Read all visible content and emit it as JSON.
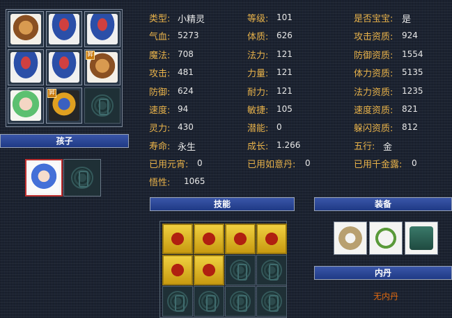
{
  "pet_list": {
    "cells": [
      {
        "icon": "monkey-sage-pet-icon",
        "art": "monkey"
      },
      {
        "icon": "shell-pet-icon",
        "art": "shell"
      },
      {
        "icon": "shell-pet-icon",
        "art": "shell"
      },
      {
        "icon": "shell-pet-icon",
        "art": "shell"
      },
      {
        "icon": "shell-pet-icon",
        "art": "shell"
      },
      {
        "icon": "monkey-pet-icon",
        "art": "monkey",
        "badge": "昇"
      },
      {
        "icon": "green-hair-girl-pet-icon",
        "art": "girl"
      },
      {
        "icon": "armored-pet-icon",
        "art": "knight",
        "badge": "昇"
      },
      {
        "icon": "empty-slot-icon",
        "art": "empty"
      }
    ]
  },
  "child": {
    "title": "孩子"
  },
  "stats": {
    "type_label": "类型:",
    "type_value": "小精灵",
    "level_label": "等级:",
    "level_value": "101",
    "baby_label": "是否宝宝:",
    "baby_value": "是",
    "hp_label": "气血:",
    "hp_value": "5273",
    "con_label": "体质:",
    "con_value": "626",
    "atk_apt_label": "攻击资质:",
    "atk_apt_value": "924",
    "mp_label": "魔法:",
    "mp_value": "708",
    "mag_label": "法力:",
    "mag_value": "121",
    "def_apt_label": "防御资质:",
    "def_apt_value": "1554",
    "atk_label": "攻击:",
    "atk_value": "481",
    "str_label": "力量:",
    "str_value": "121",
    "hp_apt_label": "体力资质:",
    "hp_apt_value": "5135",
    "def_label": "防御:",
    "def_value": "624",
    "end_label": "耐力:",
    "end_value": "121",
    "mag_apt_label": "法力资质:",
    "mag_apt_value": "1235",
    "spd_label": "速度:",
    "spd_value": "94",
    "agi_label": "敏捷:",
    "agi_value": "105",
    "spd_apt_label": "速度资质:",
    "spd_apt_value": "821",
    "sp_label": "灵力:",
    "sp_value": "430",
    "pot_label": "潜能:",
    "pot_value": "0",
    "dodge_apt_label": "躲闪资质:",
    "dodge_apt_value": "812",
    "life_label": "寿命:",
    "life_value": "永生",
    "growth_label": "成长:",
    "growth_value": "1.266",
    "elem_label": "五行:",
    "elem_value": "金",
    "yuanxiao_label": "已用元宵:",
    "yuanxiao_value": "0",
    "ruyi_label": "已用如意丹:",
    "ruyi_value": "0",
    "qianjin_label": "已用千金露:",
    "qianjin_value": "0",
    "wux_label": "悟性:",
    "wux_value": "1065"
  },
  "skills": {
    "title": "技能"
  },
  "equipment": {
    "title": "装备"
  },
  "inner_pill": {
    "title": "内丹",
    "none_text": "无内丹"
  },
  "colors": {
    "label": "#e8b24a",
    "value": "#e8e8e8",
    "accent_orange": "#e06a10",
    "bar_blue": "#2a46a0"
  }
}
